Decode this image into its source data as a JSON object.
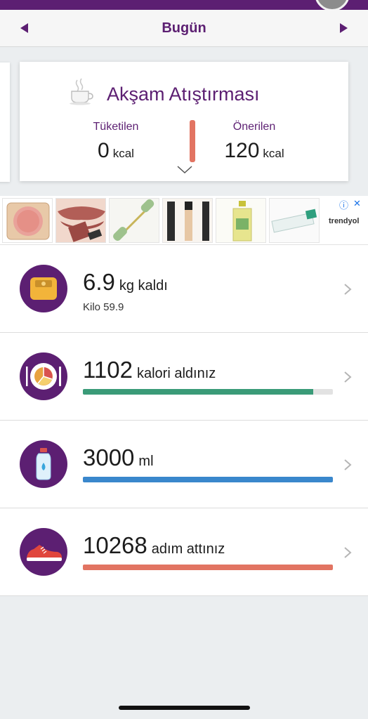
{
  "header": {
    "date_label": "Bugün"
  },
  "meal_card": {
    "title": "Akşam Atıştırması",
    "consumed_label": "Tüketilen",
    "consumed_value": "0",
    "consumed_unit": "kcal",
    "recommended_label": "Önerilen",
    "recommended_value": "120",
    "recommended_unit": "kcal",
    "icon": "coffee-cup-icon"
  },
  "ad": {
    "brand": "trendyol",
    "products": [
      "blush-product",
      "lipstick-product",
      "jade-roller-product",
      "concealer-product",
      "bottle-product",
      "toothpaste-product"
    ]
  },
  "summary": {
    "weight": {
      "value": "6.9",
      "suffix": "kg kaldı",
      "sub": "Kilo 59.9",
      "icon": "scale-icon"
    },
    "calories": {
      "value": "1102",
      "suffix": "kalori aldınız",
      "progress": 0.92,
      "color": "#3a9b78",
      "icon": "plate-icon"
    },
    "water": {
      "value": "3000",
      "suffix": "ml",
      "progress": 1.0,
      "color": "#3a87cc",
      "icon": "water-bottle-icon"
    },
    "steps": {
      "value": "10268",
      "suffix": "adım attınız",
      "progress": 1.0,
      "color": "#e27462",
      "icon": "sneaker-icon"
    }
  },
  "colors": {
    "brand_purple": "#5c1f72",
    "meal_bar": "#e27462"
  }
}
